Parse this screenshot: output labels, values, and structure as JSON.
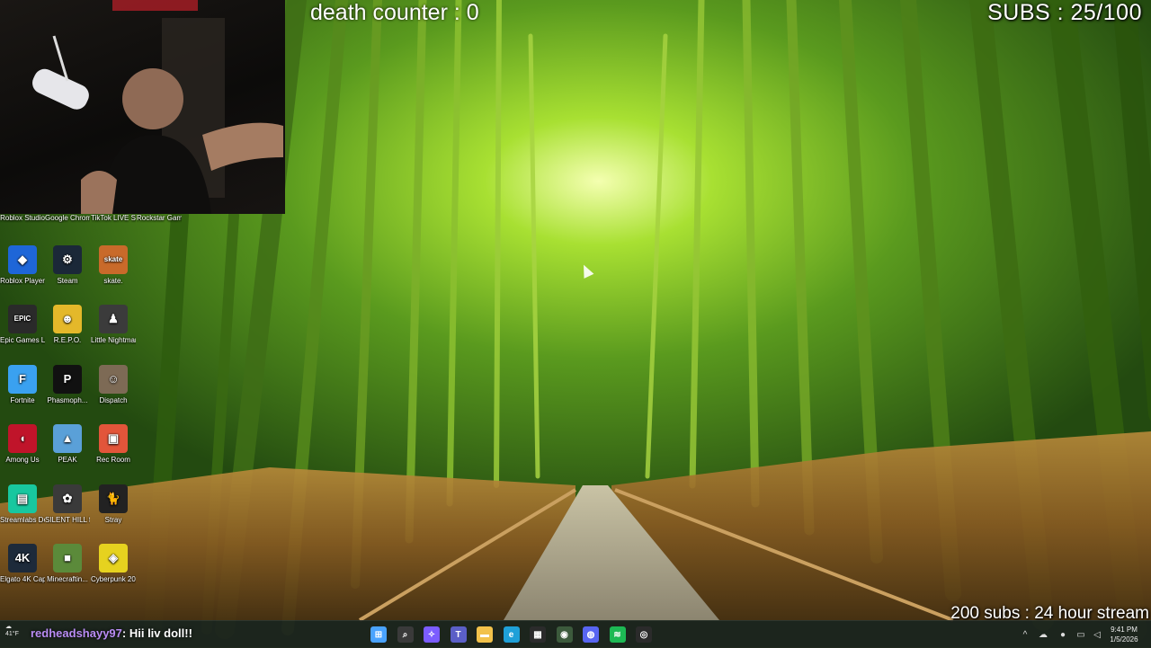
{
  "overlays": {
    "subs_counter": "SUBS : 25/100",
    "sub_goal": "200 subs : 24 hour stream",
    "death_counter": "death counter : 0"
  },
  "desktop_icons": [
    {
      "label": "Roblox Studio",
      "icon": "roblox-studio-icon",
      "color": "#1b6fd6",
      "glyph": "◢"
    },
    {
      "label": "Google Chrome",
      "icon": "chrome-icon",
      "color": "#e8453c",
      "glyph": "●"
    },
    {
      "label": "TikTok LIVE Studio",
      "icon": "tiktok-icon",
      "color": "#111111",
      "glyph": "♪"
    },
    {
      "label": "Rockstar Games...",
      "icon": "rockstar-icon",
      "color": "#f4a200",
      "glyph": "R"
    },
    {
      "label": "Roblox Player",
      "icon": "roblox-player-icon",
      "color": "#1e66d8",
      "glyph": "◆"
    },
    {
      "label": "Steam",
      "icon": "steam-icon",
      "color": "#1b2838",
      "glyph": "⚙"
    },
    {
      "label": "skate.",
      "icon": "skate-icon",
      "color": "#c96a2a",
      "glyph": "skate"
    },
    {
      "label": "Epic Games Launcher",
      "icon": "epic-games-icon",
      "color": "#2a2a2a",
      "glyph": "EPIC"
    },
    {
      "label": "R.E.P.O.",
      "icon": "repo-icon",
      "color": "#e4b82a",
      "glyph": "☻"
    },
    {
      "label": "Little Nightmar...",
      "icon": "little-nightmares-icon",
      "color": "#3b3b3b",
      "glyph": "♟"
    },
    {
      "label": "Fortnite",
      "icon": "fortnite-icon",
      "color": "#3aa1f0",
      "glyph": "F"
    },
    {
      "label": "Phasmoph...",
      "icon": "phasmophobia-icon",
      "color": "#111111",
      "glyph": "P"
    },
    {
      "label": "Dispatch",
      "icon": "dispatch-icon",
      "color": "#7d6a55",
      "glyph": "☺"
    },
    {
      "label": "Among Us",
      "icon": "among-us-icon",
      "color": "#c0142a",
      "glyph": "◖"
    },
    {
      "label": "PEAK",
      "icon": "peak-icon",
      "color": "#5aa0d8",
      "glyph": "▲"
    },
    {
      "label": "Rec Room",
      "icon": "rec-room-icon",
      "color": "#e2553a",
      "glyph": "▣"
    },
    {
      "label": "Streamlabs Desktop",
      "icon": "streamlabs-icon",
      "color": "#18c79f",
      "glyph": "▤"
    },
    {
      "label": "SILENT HILL f",
      "icon": "silent-hill-icon",
      "color": "#3a3a3a",
      "glyph": "✿"
    },
    {
      "label": "Stray",
      "icon": "stray-icon",
      "color": "#222222",
      "glyph": "🐈"
    },
    {
      "label": "Elgato 4K Captur...",
      "icon": "elgato-icon",
      "color": "#1d2a3a",
      "glyph": "4K"
    },
    {
      "label": "Minecraftin...",
      "icon": "minecraft-icon",
      "color": "#5b8a3a",
      "glyph": "■"
    },
    {
      "label": "Cyberpunk 2077",
      "icon": "cyberpunk-icon",
      "color": "#e6d21f",
      "glyph": "◈"
    }
  ],
  "taskbar": {
    "weather_temp": "41°F",
    "chat_user": "redheadshayy97",
    "chat_message": ": Hii liv doll!!",
    "pinned_apps": [
      {
        "icon": "start-icon",
        "color": "#4aa3ff",
        "glyph": "⊞"
      },
      {
        "icon": "search-icon",
        "color": "#3a3a3a",
        "glyph": "⌕"
      },
      {
        "icon": "copilot-icon",
        "color": "#7b5cff",
        "glyph": "✧"
      },
      {
        "icon": "teams-icon",
        "color": "#5b5fc7",
        "glyph": "T"
      },
      {
        "icon": "file-explorer-icon",
        "color": "#f2c24b",
        "glyph": "▬"
      },
      {
        "icon": "edge-icon",
        "color": "#1fa0d8",
        "glyph": "e"
      },
      {
        "icon": "store-icon",
        "color": "#2b2b2b",
        "glyph": "▦"
      },
      {
        "icon": "app-icon",
        "color": "#3c5a3c",
        "glyph": "◉"
      },
      {
        "icon": "discord-icon",
        "color": "#5865f2",
        "glyph": "◍"
      },
      {
        "icon": "spotify-icon",
        "color": "#1db954",
        "glyph": "≋"
      },
      {
        "icon": "obs-icon",
        "color": "#2b2b2b",
        "glyph": "◎"
      }
    ],
    "clock_time": "9:41 PM",
    "clock_date": "1/5/2026"
  }
}
